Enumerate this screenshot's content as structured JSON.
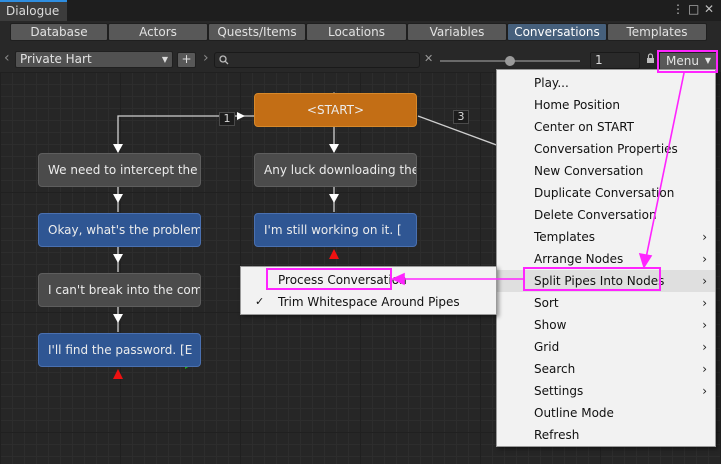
{
  "window": {
    "title": "Dialogue",
    "menu_glyph": "⋮",
    "maximize_glyph": "□",
    "close_glyph": "✕"
  },
  "tabs": [
    {
      "label": "Database"
    },
    {
      "label": "Actors"
    },
    {
      "label": "Quests/Items"
    },
    {
      "label": "Locations"
    },
    {
      "label": "Variables"
    },
    {
      "label": "Conversations",
      "active": true
    },
    {
      "label": "Templates"
    }
  ],
  "toolbar": {
    "conversation_select": "Private Hart",
    "add_label": "+",
    "search_value": "",
    "search_icon": "search-icon",
    "clear_glyph": "✕",
    "zoom_value": "1",
    "zoom_slider": 0.5,
    "menu_label": "Menu",
    "left_arrow": "‹",
    "right_arrow": "›"
  },
  "canvas": {
    "link_labels": [
      "1",
      "3"
    ],
    "nodes": [
      {
        "text": "<START>",
        "kind": "start"
      },
      {
        "text": "We need to intercept the l",
        "kind": "npc"
      },
      {
        "text": "Any luck downloading the l",
        "kind": "npc"
      },
      {
        "text": "Okay, what's the problem?",
        "kind": "pc"
      },
      {
        "text": "I'm still working on it. [",
        "kind": "pc"
      },
      {
        "text": "I can't break into the com",
        "kind": "npc"
      },
      {
        "text": "I'll find the password. [E",
        "kind": "pc"
      }
    ]
  },
  "menu": {
    "items": [
      {
        "label": "Play..."
      },
      {
        "label": "Home Position"
      },
      {
        "label": "Center on START"
      },
      {
        "label": "Conversation Properties"
      },
      {
        "label": "New Conversation"
      },
      {
        "label": "Duplicate Conversation"
      },
      {
        "label": "Delete Conversation"
      },
      {
        "label": "Templates",
        "submenu": true
      },
      {
        "label": "Arrange Nodes",
        "submenu": true
      },
      {
        "label": "Split Pipes Into Nodes",
        "submenu": true,
        "hover": true
      },
      {
        "label": "Sort",
        "submenu": true
      },
      {
        "label": "Show",
        "submenu": true
      },
      {
        "label": "Grid",
        "submenu": true
      },
      {
        "label": "Search",
        "submenu": true
      },
      {
        "label": "Settings",
        "submenu": true
      },
      {
        "label": "Outline Mode"
      },
      {
        "label": "Refresh"
      }
    ],
    "arrow_glyph": "›"
  },
  "submenu": {
    "items": [
      {
        "label": "Process Conversation",
        "checked": false
      },
      {
        "label": "Trim Whitespace Around Pipes",
        "checked": true
      }
    ],
    "check_glyph": "✓"
  },
  "colors": {
    "highlight": "#ff24ff",
    "start_node": "#c36e15",
    "npc_node": "#4b4b4b",
    "pc_node": "#2f5693",
    "active_tab": "#46607c"
  }
}
